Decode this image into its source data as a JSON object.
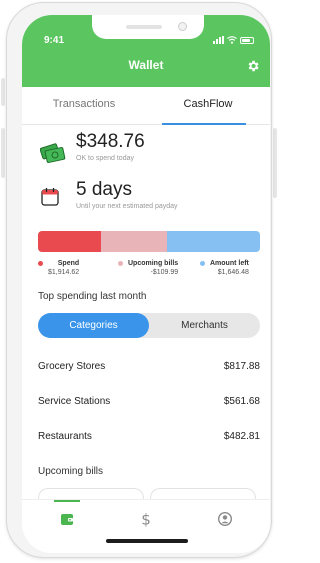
{
  "status_bar": {
    "time": "9:41"
  },
  "header": {
    "title": "Wallet",
    "settings_icon": "gear-icon"
  },
  "tabs": [
    {
      "label": "Transactions",
      "active": false
    },
    {
      "label": "CashFlow",
      "active": true
    }
  ],
  "spend_today": {
    "amount": "$348.76",
    "caption": "OK to spend today",
    "icon": "money-icon"
  },
  "payday": {
    "amount": "5 days",
    "caption": "Until your next estimated payday",
    "icon": "calendar-icon"
  },
  "breakdown": {
    "segments": [
      {
        "label": "Spend",
        "value": "$1,914.62",
        "color": "#e84a4f",
        "share": 0.285
      },
      {
        "label": "Upcoming bills",
        "value": "-$109.99",
        "color": "#e8b4b8",
        "share": 0.295
      },
      {
        "label": "Amount left",
        "value": "$1,646.48",
        "color": "#86bff2",
        "share": 0.42
      }
    ]
  },
  "top_spending": {
    "title": "Top spending last month",
    "toggle": {
      "options": [
        "Categories",
        "Merchants"
      ],
      "selected": "Categories"
    },
    "items": [
      {
        "name": "Grocery Stores",
        "amount": "$817.88"
      },
      {
        "name": "Service Stations",
        "amount": "$561.68"
      },
      {
        "name": "Restaurants",
        "amount": "$482.81"
      }
    ]
  },
  "upcoming_bills": {
    "title": "Upcoming bills"
  },
  "bottom_nav": [
    {
      "icon": "wallet-icon",
      "active": true
    },
    {
      "icon": "dollar-icon",
      "active": false
    },
    {
      "icon": "profile-icon",
      "active": false
    }
  ],
  "colors": {
    "brand_green": "#5bc65f",
    "accent_blue": "#3a95ea"
  }
}
